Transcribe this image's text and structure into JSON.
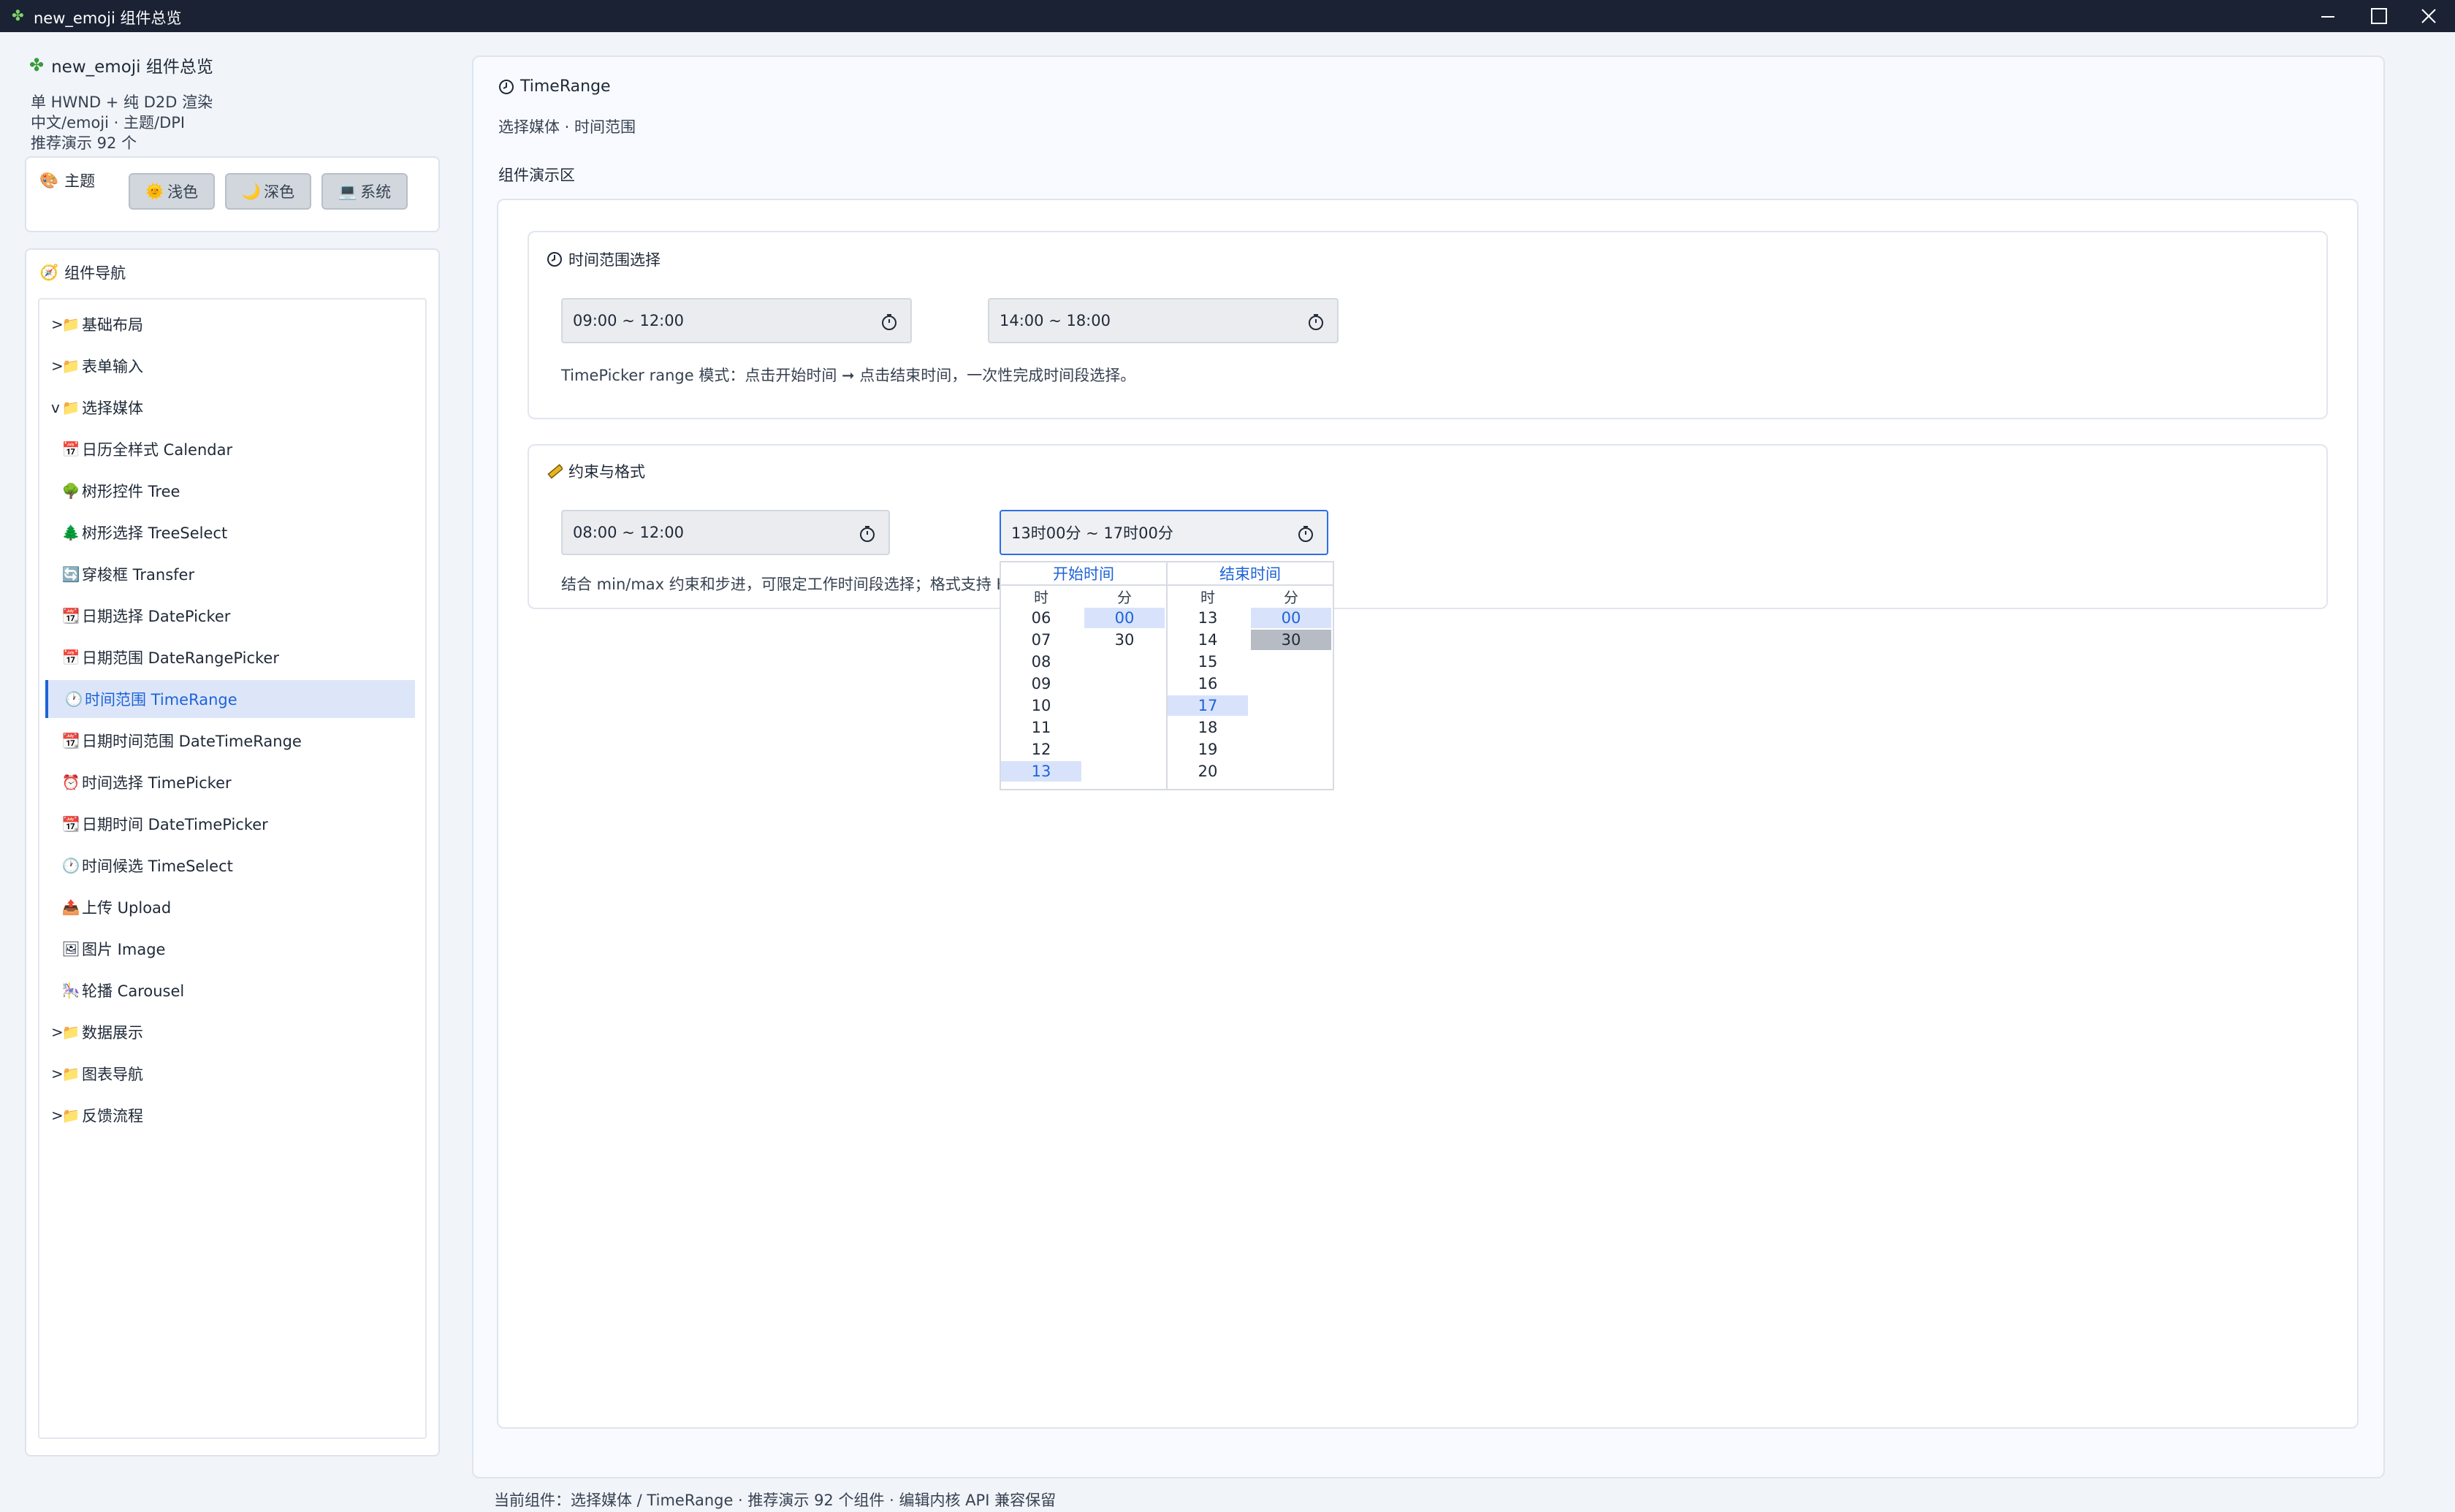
{
  "window": {
    "title": "new_emoji 组件总览"
  },
  "sidebar": {
    "app_title": "new_emoji 组件总览",
    "info": [
      "单 HWND + 纯 D2D 渲染",
      "中文/emoji · 主题/DPI",
      "推荐演示 92 个"
    ],
    "theme": {
      "label": "主题",
      "buttons": [
        {
          "icon": "🌞",
          "label": "浅色"
        },
        {
          "icon": "🌙",
          "label": "深色"
        },
        {
          "icon": "💻",
          "label": "系统"
        }
      ]
    },
    "nav": {
      "label": "组件导航",
      "items": [
        {
          "caret": ">",
          "icon": "folder",
          "label": "基础布局",
          "level": 0
        },
        {
          "caret": ">",
          "icon": "folder",
          "label": "表单输入",
          "level": 0
        },
        {
          "caret": "v",
          "icon": "folder",
          "label": "选择媒体",
          "level": 0
        },
        {
          "icon": "calendar",
          "label": "日历全样式 Calendar",
          "level": 1
        },
        {
          "icon": "tree",
          "label": "树形控件 Tree",
          "level": 1
        },
        {
          "icon": "pine",
          "label": "树形选择 TreeSelect",
          "level": 1
        },
        {
          "icon": "transfer",
          "label": "穿梭框 Transfer",
          "level": 1
        },
        {
          "icon": "date",
          "label": "日期选择 DatePicker",
          "level": 1
        },
        {
          "icon": "calendar",
          "label": "日期范围 DateRangePicker",
          "level": 1
        },
        {
          "icon": "clock",
          "label": "时间范围 TimeRange",
          "level": 1,
          "active": true
        },
        {
          "icon": "date",
          "label": "日期时间范围 DateTimeRange",
          "level": 1
        },
        {
          "icon": "alarm",
          "label": "时间选择 TimePicker",
          "level": 1
        },
        {
          "icon": "date",
          "label": "日期时间 DateTimePicker",
          "level": 1
        },
        {
          "icon": "clock",
          "label": "时间候选 TimeSelect",
          "level": 1
        },
        {
          "icon": "upload",
          "label": "上传 Upload",
          "level": 1
        },
        {
          "icon": "image",
          "label": "图片 Image",
          "level": 1
        },
        {
          "icon": "carousel",
          "label": "轮播 Carousel",
          "level": 1
        },
        {
          "caret": ">",
          "icon": "folder",
          "label": "数据展示",
          "level": 0
        },
        {
          "caret": ">",
          "icon": "folder",
          "label": "图表导航",
          "level": 0
        },
        {
          "caret": ">",
          "icon": "folder",
          "label": "反馈流程",
          "level": 0
        }
      ]
    }
  },
  "main": {
    "title": "TimeRange",
    "subtitle": "选择媒体 · 时间范围",
    "demo_label": "组件演示区",
    "section1": {
      "title": "时间范围选择",
      "field1": "09:00 ~ 12:00",
      "field2": "14:00 ~ 18:00",
      "desc": "TimePicker range 模式：点击开始时间 ➞ 点击结束时间，一次性完成时间段选择。"
    },
    "section2": {
      "title": "约束与格式",
      "field1": "08:00 ~ 12:00",
      "field2": "13时00分 ~ 17时00分",
      "desc": "结合 min/max 约束和步进，可限定工作时间段选择；格式支持 H"
    },
    "dropdown": {
      "start": {
        "header": "开始时间",
        "hour_label": "时",
        "minute_label": "分",
        "hours": [
          "06",
          "07",
          "08",
          "09",
          "10",
          "11",
          "12",
          "13"
        ],
        "minutes": [
          "00",
          "30"
        ],
        "selected_hour": "13",
        "selected_minute": "00"
      },
      "end": {
        "header": "结束时间",
        "hour_label": "时",
        "minute_label": "分",
        "hours": [
          "13",
          "14",
          "15",
          "16",
          "17",
          "18",
          "19",
          "20"
        ],
        "minutes": [
          "00",
          "30"
        ],
        "selected_hour": "17",
        "selected_minute": "00",
        "hovered_minute": "30"
      }
    }
  },
  "status": {
    "text": "当前组件：选择媒体 / TimeRange · 推荐演示 92 个组件 · 编辑内核 API 兼容保留"
  },
  "colors": {
    "accent": "#1d63d8",
    "titlebar": "#1a2233",
    "selected_bg": "#d8e3fb"
  }
}
